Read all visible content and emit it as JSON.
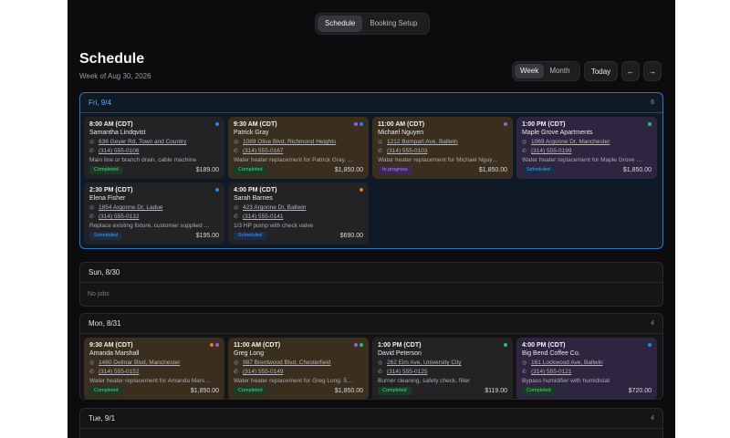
{
  "tabs": [
    {
      "label": "Schedule",
      "active": true
    },
    {
      "label": "Booking Setup",
      "active": false
    }
  ],
  "header": {
    "title": "Schedule",
    "subtitle": "Week of Aug 30, 2026"
  },
  "view_toggle": [
    {
      "label": "Week",
      "active": true
    },
    {
      "label": "Month",
      "active": false
    }
  ],
  "controls": {
    "today": "Today",
    "prev": "←",
    "next": "→"
  },
  "colors": {
    "blue": "#2f80ed",
    "purple": "#a05ad9",
    "green": "#35b86b",
    "orange": "#e5782e"
  },
  "days": [
    {
      "label": "Fri, 9/4",
      "count": "6",
      "jobs": [
        {
          "time": "8:00 AM (CDT)",
          "name": "Samantha Lindqvist",
          "address": "636 Geyer Rd, Town and Country",
          "phone": "(314) 555-0106",
          "description": "Main line or branch drain, cable machine",
          "status": "Completed",
          "price": "$189.00",
          "dots": [
            "blue"
          ],
          "theme": "gray"
        },
        {
          "time": "9:30 AM (CDT)",
          "name": "Patrick Gray",
          "address": "1089 Olive Blvd, Richmond Heights",
          "phone": "(314) 555-0167",
          "description": "Water heater replacement for Patrick Gray. …",
          "status": "Completed",
          "price": "$1,850.00",
          "dots": [
            "purple",
            "blue"
          ],
          "theme": "orange"
        },
        {
          "time": "11:00 AM (CDT)",
          "name": "Michael Nguyen",
          "address": "1212 Bompart Ave, Ballwin",
          "phone": "(314) 555-0103",
          "description": "Water heater replacement for Michael Nguy…",
          "status": "In progress",
          "price": "$1,850.00",
          "dots": [
            "purple"
          ],
          "theme": "orange"
        },
        {
          "time": "1:00 PM (CDT)",
          "name": "Maple Grove Apartments",
          "address": "1069 Argonne Dr, Manchester",
          "phone": "(314) 555-0199",
          "description": "Water heater replacement for Maple Grove …",
          "status": "Scheduled",
          "price": "$1,850.00",
          "dots": [
            "green"
          ],
          "theme": "purple"
        },
        {
          "time": "2:30 PM (CDT)",
          "name": "Elena Fisher",
          "address": "1854 Argonne Dr, Ladue",
          "phone": "(314) 555-0132",
          "description": "Replace existing fixture, customer supplied …",
          "status": "Scheduled",
          "price": "$195.00",
          "dots": [
            "blue"
          ],
          "theme": "gray"
        },
        {
          "time": "4:00 PM (CDT)",
          "name": "Sarah Barnes",
          "address": "423 Argonne Dr, Ballwin",
          "phone": "(314) 555-0141",
          "description": "1/3 HP pump with check valve",
          "status": "Scheduled",
          "price": "$690.00",
          "dots": [
            "orange"
          ],
          "theme": "gray"
        }
      ]
    },
    {
      "label": "Sun, 8/30",
      "count": "",
      "empty": "No jobs",
      "jobs": []
    },
    {
      "label": "Mon, 8/31",
      "count": "4",
      "jobs": [
        {
          "time": "9:30 AM (CDT)",
          "name": "Amanda Marshall",
          "address": "1480 Delmar Blvd, Manchester",
          "phone": "(314) 555-0152",
          "description": "Water heater replacement for Amanda Mars…",
          "status": "Completed",
          "price": "$1,850.00",
          "dots": [
            "orange",
            "purple"
          ],
          "theme": "orange"
        },
        {
          "time": "11:00 AM (CDT)",
          "name": "Greg Long",
          "address": "987 Brentwood Blvd, Chesterfield",
          "phone": "(314) 555-0149",
          "description": "Water heater replacement for Greg Long. 5…",
          "status": "Completed",
          "price": "$1,850.00",
          "dots": [
            "purple",
            "green"
          ],
          "theme": "orange"
        },
        {
          "time": "1:00 PM (CDT)",
          "name": "David Peterson",
          "address": "262 Elm Ave, University City",
          "phone": "(314) 555-0125",
          "description": "Burner cleaning, safety check, filter",
          "status": "Completed",
          "price": "$119.00",
          "dots": [
            "green"
          ],
          "theme": "gray"
        },
        {
          "time": "4:00 PM (CDT)",
          "name": "Big Bend Coffee Co.",
          "address": "161 Lockwood Ave, Ballwin",
          "phone": "(314) 555-0121",
          "description": "Bypass humidifier with humidistat",
          "status": "Completed",
          "price": "$720.00",
          "dots": [
            "blue"
          ],
          "theme": "purple"
        }
      ]
    },
    {
      "label": "Tue, 9/1",
      "count": "4",
      "jobs": []
    }
  ]
}
